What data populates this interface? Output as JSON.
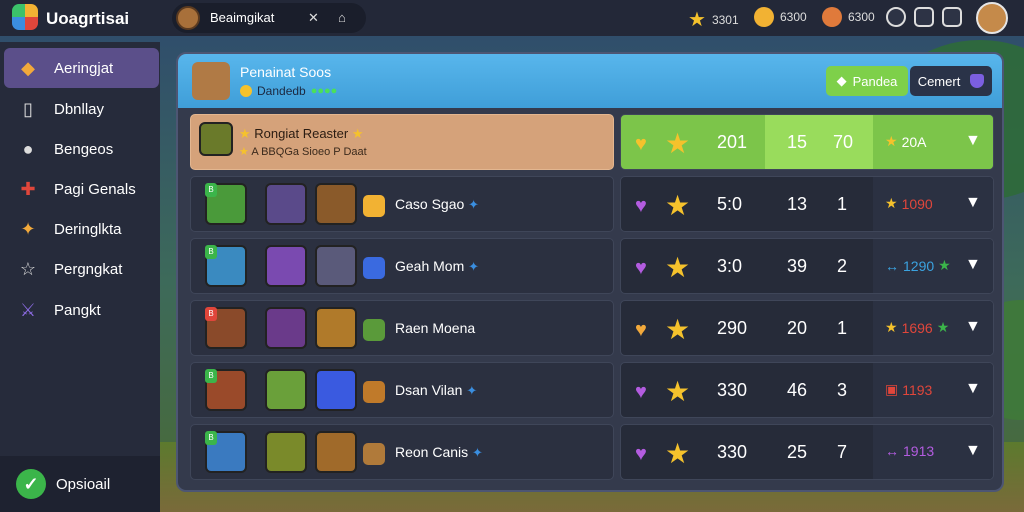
{
  "app": {
    "title": "Uoagrtisai"
  },
  "topbar": {
    "profile_name": "Beaimgikat",
    "icons": [
      "swords-icon",
      "bookmark-icon"
    ],
    "resources": [
      {
        "icon": "star-coin-icon",
        "value": "3301",
        "color": "#f5c22c"
      },
      {
        "icon": "gold-coin-icon",
        "value": "6300",
        "color": "#f2b233"
      },
      {
        "icon": "gem-face-icon",
        "value": "6300",
        "color": "#e07a3b"
      }
    ],
    "right_icons": [
      "search-icon",
      "chat-icon",
      "camera-icon",
      "avatar"
    ]
  },
  "sidebar": {
    "items": [
      {
        "label": "Aeringjat",
        "icon": "fox-icon",
        "active": true
      },
      {
        "label": "Dbnllay",
        "icon": "page-icon",
        "active": false
      },
      {
        "label": "Bengeos",
        "icon": "chat-bubble-icon",
        "active": false
      },
      {
        "label": "Pagi Genals",
        "icon": "gamepad-icon",
        "active": false
      },
      {
        "label": "Deringlkta",
        "icon": "puzzle-icon",
        "active": false
      },
      {
        "label": "Pergngkat",
        "icon": "star-outline-icon",
        "active": false
      },
      {
        "label": "Pangkt",
        "icon": "sword-icon",
        "active": false
      }
    ],
    "footer_label": "Opsioail"
  },
  "panel": {
    "header": {
      "title": "Penainat Soos",
      "subtitle": "Dandedb",
      "dots": "●●●●",
      "btn_primary": "Pandea",
      "btn_secondary": "Cemert"
    },
    "featured": {
      "title": "Rongiat Reaster",
      "subtitle": "A BBQGa Sioeo P Daat",
      "col1": "201",
      "col2": "15",
      "col3": "70",
      "rank": "20A"
    },
    "rows": [
      {
        "name": "Caso Sgao",
        "heart_color": "#b35ce0",
        "col1": "5:0",
        "col2": "13",
        "col3": "1",
        "rank": "1090",
        "rank_color": "#f5c22c",
        "rank_icon": "★"
      },
      {
        "name": "Geah Mom",
        "heart_color": "#b35ce0",
        "col1": "3:0",
        "col2": "39",
        "col3": "2",
        "rank": "1290",
        "rank_color": "#3ba3e0",
        "rank_icon": "↔"
      },
      {
        "name": "Raen Moena",
        "heart_color": "#f2a93b",
        "col1": "290",
        "col2": "20",
        "col3": "1",
        "rank": "1696",
        "rank_color": "#e0463b",
        "rank_icon": "★"
      },
      {
        "name": "Dsan Vilan",
        "heart_color": "#b35ce0",
        "col1": "330",
        "col2": "46",
        "col3": "3",
        "rank": "1193",
        "rank_color": "#e0463b",
        "rank_icon": "▣"
      },
      {
        "name": "Reon Canis",
        "heart_color": "#b35ce0",
        "col1": "330",
        "col2": "25",
        "col3": "7",
        "rank": "1913",
        "rank_color": "#b35ce0",
        "rank_icon": "↔"
      }
    ]
  }
}
